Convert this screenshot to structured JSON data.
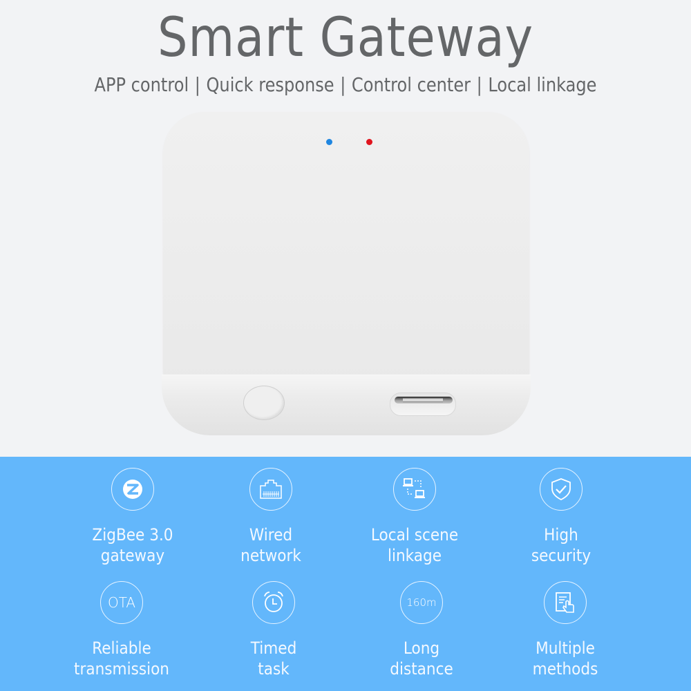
{
  "header": {
    "title": "Smart Gateway",
    "subtitle_items": [
      "APP control",
      "Quick response",
      "Control center",
      "Local linkage"
    ],
    "separator": "|"
  },
  "product": {
    "name": "Smart Gateway device",
    "led_colors": {
      "left": "#1f86e0",
      "right": "#e0141e"
    }
  },
  "features": [
    {
      "icon": "zigbee-icon",
      "icon_text": "",
      "line1": "ZigBee 3.0",
      "line2": "gateway"
    },
    {
      "icon": "ethernet-port-icon",
      "icon_text": "",
      "line1": "Wired",
      "line2": "network"
    },
    {
      "icon": "network-linkage-icon",
      "icon_text": "",
      "line1": "Local scene",
      "line2": "linkage"
    },
    {
      "icon": "shield-check-icon",
      "icon_text": "",
      "line1": "High",
      "line2": "security"
    },
    {
      "icon": "ota-icon",
      "icon_text": "OTA",
      "line1": "Reliable",
      "line2": "transmission"
    },
    {
      "icon": "alarm-clock-icon",
      "icon_text": "",
      "line1": "Timed",
      "line2": "task"
    },
    {
      "icon": "distance-icon",
      "icon_text": "160m",
      "line1": "Long",
      "line2": "distance"
    },
    {
      "icon": "touch-document-icon",
      "icon_text": "",
      "line1": "Multiple",
      "line2": "methods"
    }
  ],
  "colors": {
    "background": "#f2f3f5",
    "panel": "#63b7fb",
    "title_text": "#646668"
  }
}
